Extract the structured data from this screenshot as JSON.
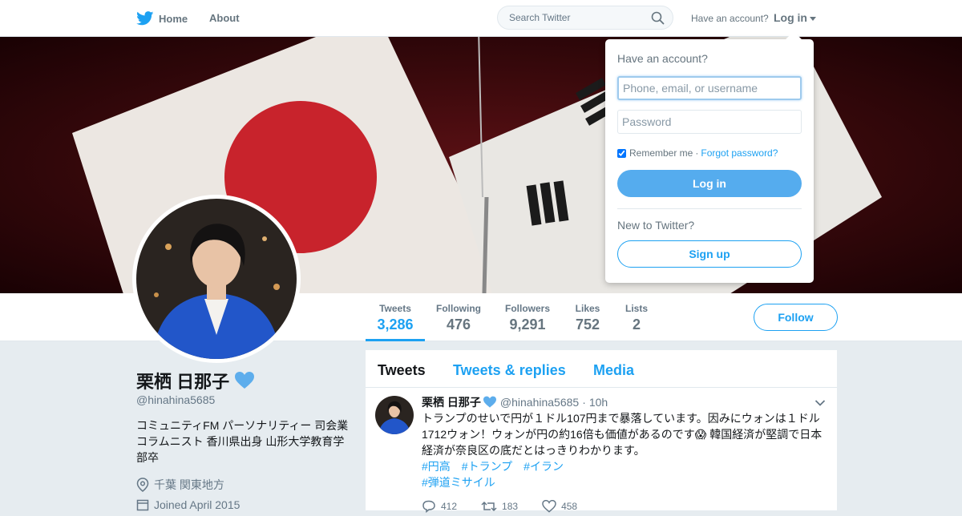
{
  "nav": {
    "home_label": "Home",
    "about_label": "About",
    "search_placeholder": "Search Twitter",
    "have_account": "Have an account?",
    "login_label": "Log in"
  },
  "login_dropdown": {
    "title": "Have an account?",
    "username_placeholder": "Phone, email, or username",
    "password_placeholder": "Password",
    "remember_label": "Remember me",
    "separator": "·",
    "forgot_label": "Forgot password?",
    "login_button": "Log in",
    "new_label": "New to Twitter?",
    "signup_button": "Sign up",
    "remember_checked": true
  },
  "profile": {
    "name": "栗栖 日那子",
    "handle": "@hinahina5685",
    "bio": "コミュニティFM パーソナリティー 司会業 コラムニスト 香川県出身 山形大学教育学部卒",
    "location": "千葉 関東地方",
    "joined": "Joined April 2015"
  },
  "stats": [
    {
      "label": "Tweets",
      "value": "3,286"
    },
    {
      "label": "Following",
      "value": "476"
    },
    {
      "label": "Followers",
      "value": "9,291"
    },
    {
      "label": "Likes",
      "value": "752"
    },
    {
      "label": "Lists",
      "value": "2"
    }
  ],
  "follow_button": "Follow",
  "timeline": {
    "tabs": [
      "Tweets",
      "Tweets & replies",
      "Media"
    ],
    "tweet": {
      "name": "栗栖 日那子",
      "handle": "@hinahina5685",
      "separator": "·",
      "time": "10h",
      "text": "トランプのせいで円が１ドル107円まで暴落しています。因みにウォンは１ドル1712ウォン！ウォンが円の約16倍も価値があるのです😱 韓国経済が堅調で日本経済が奈良区の底だとはっきりわかります。",
      "hashtags": [
        "#円高",
        "#トランプ",
        "#イラン",
        "#弾道ミサイル"
      ],
      "replies": "412",
      "retweets": "183",
      "likes": "458"
    }
  },
  "colors": {
    "accent": "#1da1f2",
    "login_button": "#55acee",
    "page_bg": "#e6ecf0"
  }
}
